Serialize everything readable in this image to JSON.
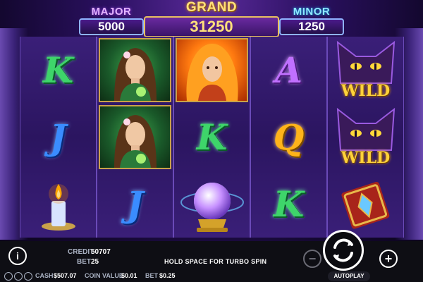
{
  "jackpots": {
    "major": {
      "label": "MAJOR",
      "value": "5000"
    },
    "grand": {
      "label": "GRAND",
      "value": "31250"
    },
    "minor": {
      "label": "MINOR",
      "value": "1250"
    }
  },
  "reels": [
    [
      "K",
      "J",
      "candle-icon"
    ],
    [
      "green-sorceress-portrait",
      "green-sorceress-portrait",
      "J"
    ],
    [
      "fire-sorceress-portrait",
      "K",
      "crystal-ball-icon"
    ],
    [
      "A",
      "Q",
      "K"
    ],
    [
      "black-cat-wild",
      "black-cat-wild",
      "spellbook-icon"
    ]
  ],
  "wild_label": "WILD",
  "status": {
    "credit_label": "CREDIT",
    "credit_value": "50707",
    "bet_label": "BET",
    "bet_value": "25",
    "hint": "HOLD SPACE FOR TURBO SPIN",
    "cash_label": "CASH",
    "cash_value": "$507.07",
    "coin_value_label": "COIN VALUE",
    "coin_value": "$0.01",
    "bet2_label": "BET",
    "bet2_value": "$0.25"
  },
  "controls": {
    "info": "i",
    "minus": "−",
    "plus": "+",
    "autoplay": "AUTOPLAY"
  },
  "colors": {
    "k": "#3ed56a",
    "j": "#3a8cff",
    "a": "#c070ff",
    "q": "#ffb31a",
    "gold": "#ffd23a"
  }
}
